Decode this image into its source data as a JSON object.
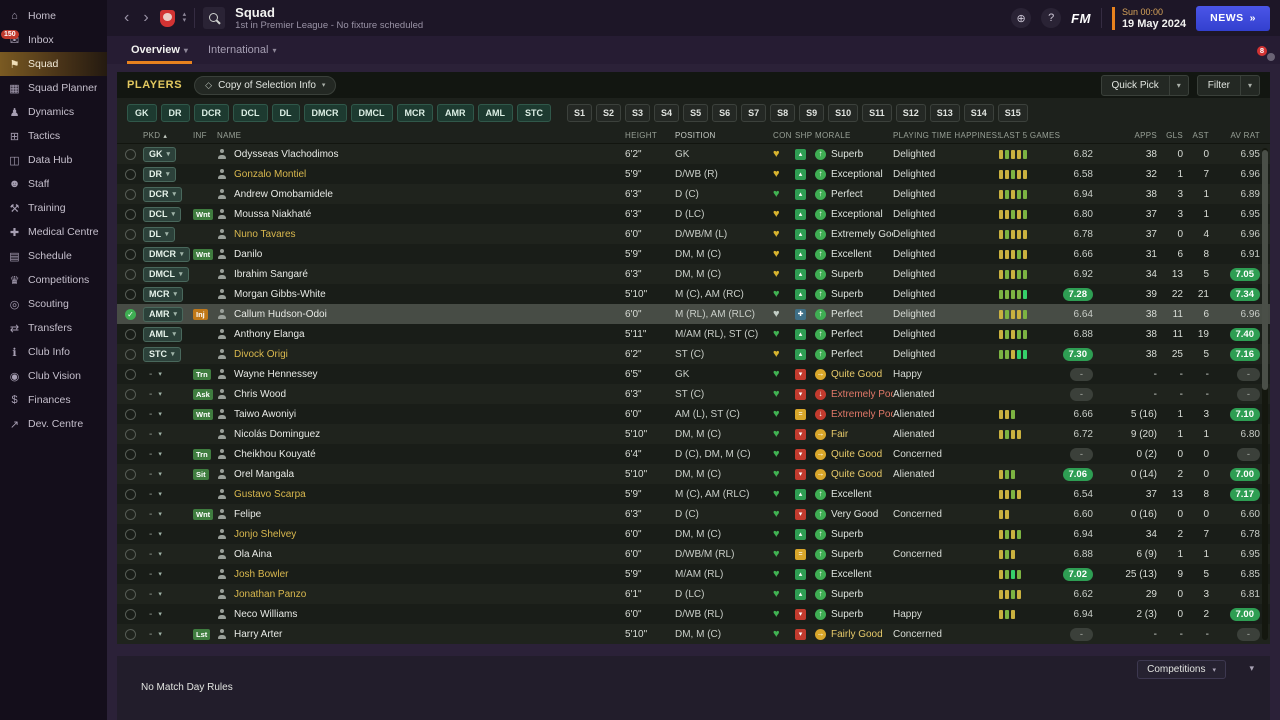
{
  "colors": {
    "accent": "#e8821e",
    "pill_green": "#2e9e53",
    "loan_yellow": "#d9b84e",
    "news_blue": "#3c49de"
  },
  "sidebar": {
    "items": [
      {
        "label": "Home",
        "icon": "home-icon"
      },
      {
        "label": "Inbox",
        "icon": "inbox-icon",
        "badge": "150"
      },
      {
        "label": "Squad",
        "icon": "squad-icon",
        "active": true
      },
      {
        "label": "Squad Planner",
        "icon": "squad-planner-icon"
      },
      {
        "label": "Dynamics",
        "icon": "dynamics-icon"
      },
      {
        "label": "Tactics",
        "icon": "tactics-icon"
      },
      {
        "label": "Data Hub",
        "icon": "data-hub-icon"
      },
      {
        "label": "Staff",
        "icon": "staff-icon"
      },
      {
        "label": "Training",
        "icon": "training-icon"
      },
      {
        "label": "Medical Centre",
        "icon": "medical-icon"
      },
      {
        "label": "Schedule",
        "icon": "schedule-icon"
      },
      {
        "label": "Competitions",
        "icon": "competitions-icon"
      },
      {
        "label": "Scouting",
        "icon": "scouting-icon"
      },
      {
        "label": "Transfers",
        "icon": "transfers-icon"
      },
      {
        "label": "Club Info",
        "icon": "club-info-icon"
      },
      {
        "label": "Club Vision",
        "icon": "club-vision-icon"
      },
      {
        "label": "Finances",
        "icon": "finances-icon"
      },
      {
        "label": "Dev. Centre",
        "icon": "dev-centre-icon"
      }
    ]
  },
  "header": {
    "title": "Squad",
    "subtitle": "1st in Premier League - No fixture scheduled",
    "date_line1": "Sun 00:00",
    "date_line2": "19 May 2024",
    "news_label": "NEWS",
    "news_arrows": "»"
  },
  "tabs": [
    {
      "label": "Overview",
      "active": true
    },
    {
      "label": "International",
      "active": false
    }
  ],
  "players_bar": {
    "title": "PLAYERS",
    "selection_dropdown": "Copy of Selection Info",
    "quick_pick_label": "Quick Pick",
    "filter_label": "Filter",
    "position_filters": [
      "GK",
      "DR",
      "DCR",
      "DCL",
      "DL",
      "DMCR",
      "DMCL",
      "MCR",
      "AMR",
      "AML",
      "STC"
    ],
    "slot_filters": [
      "S1",
      "S2",
      "S3",
      "S4",
      "S5",
      "S6",
      "S7",
      "S8",
      "S9",
      "S10",
      "S11",
      "S12",
      "S13",
      "S14",
      "S15"
    ]
  },
  "table": {
    "columns": [
      {
        "key": "sel",
        "label": ""
      },
      {
        "key": "pkd",
        "label": "PKD",
        "sort": true
      },
      {
        "key": "inf",
        "label": "INF"
      },
      {
        "key": "name",
        "label": "NAME"
      },
      {
        "key": "height",
        "label": "HEIGHT"
      },
      {
        "key": "pos",
        "label": "POSITION"
      },
      {
        "key": "con",
        "label": "CON"
      },
      {
        "key": "shp",
        "label": "SHP"
      },
      {
        "key": "morale",
        "label": "MORALE"
      },
      {
        "key": "happy",
        "label": "PLAYING TIME HAPPINESS"
      },
      {
        "key": "last5",
        "label": "LAST 5 GAMES"
      },
      {
        "key": "apps",
        "label": "APPS",
        "num": true
      },
      {
        "key": "gls",
        "label": "GLS",
        "num": true
      },
      {
        "key": "ast",
        "label": "AST",
        "num": true
      },
      {
        "key": "avrat",
        "label": "AV RAT",
        "num": true
      }
    ],
    "rows": [
      {
        "pkd": "GK",
        "inf": "",
        "name": "Odysseas Vlachodimos",
        "name_color": "w",
        "height": "6'2\"",
        "position": "GK",
        "con": "o",
        "shp": "up",
        "morale": "Superb",
        "morale_level": "g",
        "happiness": "Delighted",
        "last5_bars": "ygyyg",
        "last5": "6.82",
        "last5_hl": false,
        "apps": "38",
        "gls": "0",
        "ast": "0",
        "avrat": "6.95",
        "avrat_hl": false,
        "selected": false
      },
      {
        "pkd": "DR",
        "inf": "",
        "name": "Gonzalo Montiel",
        "name_color": "y",
        "height": "5'9\"",
        "position": "D/WB (R)",
        "con": "o",
        "shp": "up",
        "morale": "Exceptional",
        "morale_level": "g",
        "happiness": "Delighted",
        "last5_bars": "yygyy",
        "last5": "6.58",
        "last5_hl": false,
        "apps": "32",
        "gls": "1",
        "ast": "7",
        "avrat": "6.96",
        "avrat_hl": false,
        "selected": false
      },
      {
        "pkd": "DCR",
        "inf": "",
        "name": "Andrew Omobamidele",
        "name_color": "w",
        "height": "6'3\"",
        "position": "D (C)",
        "con": "g",
        "shp": "up",
        "morale": "Perfect",
        "morale_level": "g",
        "happiness": "Delighted",
        "last5_bars": "ygygg",
        "last5": "6.94",
        "last5_hl": false,
        "apps": "38",
        "gls": "3",
        "ast": "1",
        "avrat": "6.89",
        "avrat_hl": false,
        "selected": false
      },
      {
        "pkd": "DCL",
        "inf": "Wnt",
        "inf_color": "green",
        "name": "Moussa Niakhaté",
        "name_color": "w",
        "height": "6'3\"",
        "position": "D (LC)",
        "con": "o",
        "shp": "up",
        "morale": "Exceptional",
        "morale_level": "g",
        "happiness": "Delighted",
        "last5_bars": "yygyg",
        "last5": "6.80",
        "last5_hl": false,
        "apps": "37",
        "gls": "3",
        "ast": "1",
        "avrat": "6.95",
        "avrat_hl": false,
        "selected": false
      },
      {
        "pkd": "DL",
        "inf": "",
        "name": "Nuno Tavares",
        "name_color": "y",
        "height": "6'0\"",
        "position": "D/WB/M (L)",
        "con": "o",
        "shp": "up",
        "morale": "Extremely Good",
        "morale_level": "g",
        "happiness": "Delighted",
        "last5_bars": "ygyyy",
        "last5": "6.78",
        "last5_hl": false,
        "apps": "37",
        "gls": "0",
        "ast": "4",
        "avrat": "6.96",
        "avrat_hl": false,
        "selected": false
      },
      {
        "pkd": "DMCR",
        "inf": "Wnt",
        "inf_color": "green",
        "name": "Danilo",
        "name_color": "w",
        "height": "5'9\"",
        "position": "DM, M (C)",
        "con": "o",
        "shp": "up",
        "morale": "Excellent",
        "morale_level": "g",
        "happiness": "Delighted",
        "last5_bars": "yyygy",
        "last5": "6.66",
        "last5_hl": false,
        "apps": "31",
        "gls": "6",
        "ast": "8",
        "avrat": "6.91",
        "avrat_hl": false,
        "selected": false
      },
      {
        "pkd": "DMCL",
        "inf": "",
        "name": "Ibrahim Sangaré",
        "name_color": "w",
        "height": "6'3\"",
        "position": "DM, M (C)",
        "con": "o",
        "shp": "up",
        "morale": "Superb",
        "morale_level": "g",
        "happiness": "Delighted",
        "last5_bars": "ygygg",
        "last5": "6.92",
        "last5_hl": false,
        "apps": "34",
        "gls": "13",
        "ast": "5",
        "avrat": "7.05",
        "avrat_hl": true,
        "selected": false
      },
      {
        "pkd": "MCR",
        "inf": "",
        "name": "Morgan Gibbs-White",
        "name_color": "w",
        "height": "5'10\"",
        "position": "M (C), AM (RC)",
        "con": "g",
        "shp": "up",
        "morale": "Superb",
        "morale_level": "g",
        "happiness": "Delighted",
        "last5_bars": "ggggG",
        "last5": "7.28",
        "last5_hl": true,
        "apps": "39",
        "gls": "22",
        "ast": "21",
        "avrat": "7.34",
        "avrat_hl": true,
        "selected": false
      },
      {
        "pkd": "AMR",
        "inf": "Inj",
        "inf_color": "orange",
        "name": "Callum Hudson-Odoi",
        "name_color": "w",
        "height": "6'0\"",
        "position": "M (RL), AM (RLC)",
        "con": "p",
        "shp": "inj",
        "morale": "Perfect",
        "morale_level": "g",
        "happiness": "Delighted",
        "last5_bars": "ygyyg",
        "last5": "6.64",
        "last5_hl": false,
        "apps": "38",
        "gls": "11",
        "ast": "6",
        "avrat": "6.96",
        "avrat_hl": false,
        "selected": true
      },
      {
        "pkd": "AML",
        "inf": "",
        "name": "Anthony Elanga",
        "name_color": "w",
        "height": "5'11\"",
        "position": "M/AM (RL), ST (C)",
        "con": "g",
        "shp": "up",
        "morale": "Perfect",
        "morale_level": "g",
        "happiness": "Delighted",
        "last5_bars": "ygygg",
        "last5": "6.88",
        "last5_hl": false,
        "apps": "38",
        "gls": "11",
        "ast": "19",
        "avrat": "7.40",
        "avrat_hl": true,
        "selected": false
      },
      {
        "pkd": "STC",
        "inf": "",
        "name": "Divock Origi",
        "name_color": "y",
        "height": "6'2\"",
        "position": "ST (C)",
        "con": "o",
        "shp": "up",
        "morale": "Perfect",
        "morale_level": "g",
        "happiness": "Delighted",
        "last5_bars": "ggyGG",
        "last5": "7.30",
        "last5_hl": true,
        "apps": "38",
        "gls": "25",
        "ast": "5",
        "avrat": "7.16",
        "avrat_hl": true,
        "selected": false
      },
      {
        "pkd": "-",
        "inf": "Trn",
        "inf_color": "green",
        "name": "Wayne Hennessey",
        "name_color": "w",
        "height": "6'5\"",
        "position": "GK",
        "con": "g",
        "shp": "down",
        "morale": "Quite Good",
        "morale_level": "y",
        "happiness": "Happy",
        "last5_bars": "",
        "last5": "-",
        "last5_hl": false,
        "apps": "-",
        "gls": "-",
        "ast": "-",
        "avrat": "-",
        "avrat_hl": false,
        "selected": false
      },
      {
        "pkd": "-",
        "inf": "Ask",
        "inf_color": "green",
        "name": "Chris Wood",
        "name_color": "w",
        "height": "6'3\"",
        "position": "ST (C)",
        "con": "g",
        "shp": "down",
        "morale": "Extremely Poor",
        "morale_level": "r",
        "happiness": "Alienated",
        "last5_bars": "",
        "last5": "-",
        "last5_hl": false,
        "apps": "-",
        "gls": "-",
        "ast": "-",
        "avrat": "-",
        "avrat_hl": false,
        "selected": false
      },
      {
        "pkd": "-",
        "inf": "Wnt",
        "inf_color": "green",
        "name": "Taiwo Awoniyi",
        "name_color": "w",
        "height": "6'0\"",
        "position": "AM (L), ST (C)",
        "con": "g",
        "shp": "flat",
        "morale": "Extremely Poor",
        "morale_level": "r",
        "happiness": "Alienated",
        "last5_bars": "yyg",
        "last5": "6.66",
        "last5_hl": false,
        "apps": "5 (16)",
        "gls": "1",
        "ast": "3",
        "avrat": "7.10",
        "avrat_hl": true,
        "selected": false
      },
      {
        "pkd": "-",
        "inf": "",
        "name": "Nicolás Dominguez",
        "name_color": "w",
        "height": "5'10\"",
        "position": "DM, M (C)",
        "con": "g",
        "shp": "down",
        "morale": "Fair",
        "morale_level": "y",
        "happiness": "Alienated",
        "last5_bars": "ygyy",
        "last5": "6.72",
        "last5_hl": false,
        "apps": "9 (20)",
        "gls": "1",
        "ast": "1",
        "avrat": "6.80",
        "avrat_hl": false,
        "selected": false
      },
      {
        "pkd": "-",
        "inf": "Trn",
        "inf_color": "green",
        "name": "Cheikhou Kouyaté",
        "name_color": "w",
        "height": "6'4\"",
        "position": "D (C), DM, M (C)",
        "con": "g",
        "shp": "down",
        "morale": "Quite Good",
        "morale_level": "y",
        "happiness": "Concerned",
        "last5_bars": "",
        "last5": "-",
        "last5_hl": false,
        "apps": "0 (2)",
        "gls": "0",
        "ast": "0",
        "avrat": "-",
        "avrat_hl": false,
        "selected": false
      },
      {
        "pkd": "-",
        "inf": "Sit",
        "inf_color": "green",
        "name": "Orel Mangala",
        "name_color": "w",
        "height": "5'10\"",
        "position": "DM, M (C)",
        "con": "g",
        "shp": "down",
        "morale": "Quite Good",
        "morale_level": "y",
        "happiness": "Alienated",
        "last5_bars": "ygg",
        "last5": "7.06",
        "last5_hl": true,
        "apps": "0 (14)",
        "gls": "2",
        "ast": "0",
        "avrat": "7.00",
        "avrat_hl": true,
        "selected": false
      },
      {
        "pkd": "-",
        "inf": "",
        "name": "Gustavo Scarpa",
        "name_color": "y",
        "height": "5'9\"",
        "position": "M (C), AM (RLC)",
        "con": "g",
        "shp": "up",
        "morale": "Excellent",
        "morale_level": "g",
        "happiness": "",
        "last5_bars": "yygy",
        "last5": "6.54",
        "last5_hl": false,
        "apps": "37",
        "gls": "13",
        "ast": "8",
        "avrat": "7.17",
        "avrat_hl": true,
        "selected": false
      },
      {
        "pkd": "-",
        "inf": "Wnt",
        "inf_color": "green",
        "name": "Felipe",
        "name_color": "w",
        "height": "6'3\"",
        "position": "D (C)",
        "con": "g",
        "shp": "down",
        "morale": "Very Good",
        "morale_level": "g",
        "happiness": "Concerned",
        "last5_bars": "yy",
        "last5": "6.60",
        "last5_hl": false,
        "apps": "0 (16)",
        "gls": "0",
        "ast": "0",
        "avrat": "6.60",
        "avrat_hl": false,
        "selected": false
      },
      {
        "pkd": "-",
        "inf": "",
        "name": "Jonjo Shelvey",
        "name_color": "y",
        "height": "6'0\"",
        "position": "DM, M (C)",
        "con": "g",
        "shp": "up",
        "morale": "Superb",
        "morale_level": "g",
        "happiness": "",
        "last5_bars": "ygyg",
        "last5": "6.94",
        "last5_hl": false,
        "apps": "34",
        "gls": "2",
        "ast": "7",
        "avrat": "6.78",
        "avrat_hl": false,
        "selected": false
      },
      {
        "pkd": "-",
        "inf": "",
        "name": "Ola Aina",
        "name_color": "w",
        "height": "6'0\"",
        "position": "D/WB/M (RL)",
        "con": "g",
        "shp": "flat",
        "morale": "Superb",
        "morale_level": "g",
        "happiness": "Concerned",
        "last5_bars": "ygy",
        "last5": "6.88",
        "last5_hl": false,
        "apps": "6 (9)",
        "gls": "1",
        "ast": "1",
        "avrat": "6.95",
        "avrat_hl": false,
        "selected": false
      },
      {
        "pkd": "-",
        "inf": "",
        "name": "Josh Bowler",
        "name_color": "y",
        "height": "5'9\"",
        "position": "M/AM (RL)",
        "con": "g",
        "shp": "up",
        "morale": "Excellent",
        "morale_level": "g",
        "happiness": "",
        "last5_bars": "ygGg",
        "last5": "7.02",
        "last5_hl": true,
        "apps": "25 (13)",
        "gls": "9",
        "ast": "5",
        "avrat": "6.85",
        "avrat_hl": false,
        "selected": false
      },
      {
        "pkd": "-",
        "inf": "",
        "name": "Jonathan Panzo",
        "name_color": "y",
        "height": "6'1\"",
        "position": "D (LC)",
        "con": "g",
        "shp": "up",
        "morale": "Superb",
        "morale_level": "g",
        "happiness": "",
        "last5_bars": "yygy",
        "last5": "6.62",
        "last5_hl": false,
        "apps": "29",
        "gls": "0",
        "ast": "3",
        "avrat": "6.81",
        "avrat_hl": false,
        "selected": false
      },
      {
        "pkd": "-",
        "inf": "",
        "name": "Neco Williams",
        "name_color": "w",
        "height": "6'0\"",
        "position": "D/WB (RL)",
        "con": "g",
        "shp": "down",
        "morale": "Superb",
        "morale_level": "g",
        "happiness": "Happy",
        "last5_bars": "ygy",
        "last5": "6.94",
        "last5_hl": false,
        "apps": "2 (3)",
        "gls": "0",
        "ast": "2",
        "avrat": "7.00",
        "avrat_hl": true,
        "selected": false
      },
      {
        "pkd": "-",
        "inf": "Lst",
        "inf_color": "green",
        "name": "Harry Arter",
        "name_color": "w",
        "height": "5'10\"",
        "position": "DM, M (C)",
        "con": "g",
        "shp": "down",
        "morale": "Fairly Good",
        "morale_level": "y",
        "happiness": "Concerned",
        "last5_bars": "",
        "last5": "-",
        "last5_hl": false,
        "apps": "-",
        "gls": "-",
        "ast": "-",
        "avrat": "-",
        "avrat_hl": false,
        "selected": false
      }
    ]
  },
  "footer": {
    "note": "No Match Day Rules",
    "competitions_label": "Competitions"
  }
}
